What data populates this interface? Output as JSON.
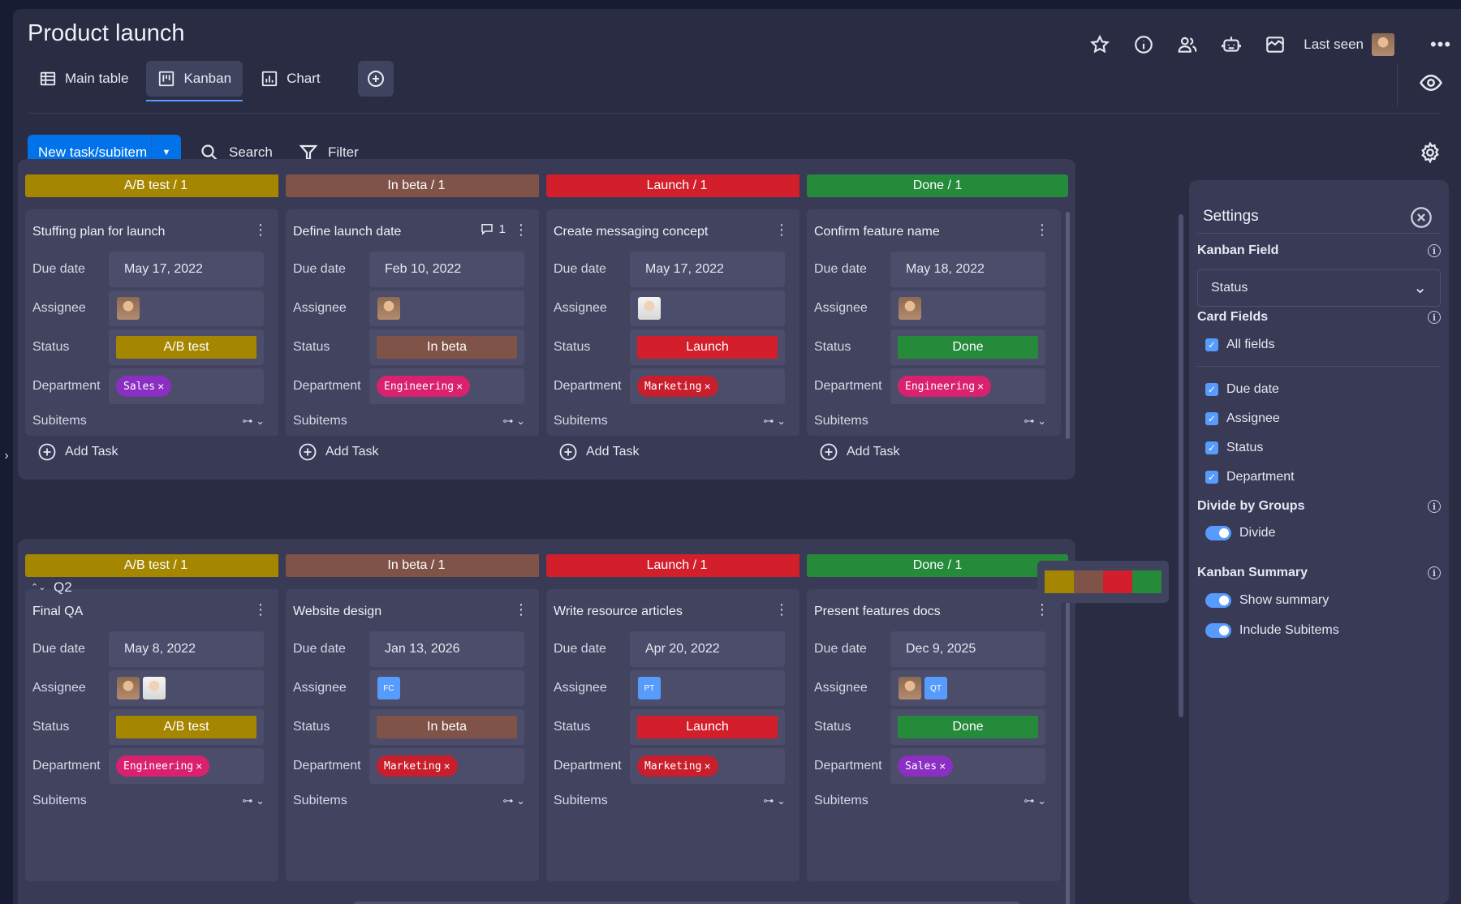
{
  "app": {
    "title": "Product launch",
    "last_seen_label": "Last seen",
    "more_label": "•••"
  },
  "tabs": [
    {
      "label": "Main table",
      "icon": "table-icon"
    },
    {
      "label": "Kanban",
      "icon": "kanban-icon",
      "active": true
    },
    {
      "label": "Chart",
      "icon": "chart-icon"
    }
  ],
  "toolbar": {
    "new_label": "New task/subitem",
    "dropdown_glyph": "▼",
    "search_label": "Search",
    "filter_label": "Filter"
  },
  "labels": {
    "due_date": "Due date",
    "assignee": "Assignee",
    "status": "Status",
    "department": "Department",
    "subitems": "Subitems",
    "add_task": "Add Task",
    "remove": "×",
    "menu": "⋮",
    "tree": "⊶ ⌄"
  },
  "colors": {
    "ab_test": "#a58600",
    "in_beta": "#7f5347",
    "launch": "#d21f2b",
    "done": "#258a3a",
    "sales": "#8b2fc2",
    "engineering": "#d9216f",
    "marketing": "#c91f2c",
    "accent": "#0073ea"
  },
  "groups": [
    {
      "columns": [
        {
          "header": "A/B test / 1",
          "card": {
            "title": "Stuffing plan for launch",
            "due": "May 17, 2022",
            "assignees": [
              "photo-a"
            ],
            "status": "A/B test",
            "department": "Sales"
          }
        },
        {
          "header": "In beta / 1",
          "card": {
            "title": "Define launch date",
            "comments": "1",
            "due": "Feb 10, 2022",
            "assignees": [
              "photo-a"
            ],
            "status": "In beta",
            "department": "Engineering"
          }
        },
        {
          "header": "Launch / 1",
          "card": {
            "title": "Create messaging concept",
            "due": "May 17, 2022",
            "assignees": [
              "photo-b"
            ],
            "status": "Launch",
            "department": "Marketing"
          }
        },
        {
          "header": "Done / 1",
          "card": {
            "title": "Confirm feature name",
            "due": "May 18, 2022",
            "assignees": [
              "photo-a"
            ],
            "status": "Done",
            "department": "Engineering"
          }
        }
      ]
    },
    {
      "name": "Q2",
      "collapse_glyph": "⌃⌄",
      "columns": [
        {
          "header": "A/B test / 1",
          "card": {
            "title": "Final QA",
            "due": "May 8, 2022",
            "assignees": [
              "photo-a",
              "photo-b"
            ],
            "status": "A/B test",
            "department": "Engineering"
          }
        },
        {
          "header": "In beta / 1",
          "card": {
            "title": "Website design",
            "due": "Jan 13, 2026",
            "assignees": [
              "FC"
            ],
            "status": "In beta",
            "department": "Marketing"
          }
        },
        {
          "header": "Launch / 1",
          "card": {
            "title": "Write resource articles",
            "due": "Apr 20, 2022",
            "assignees": [
              "PT"
            ],
            "status": "Launch",
            "department": "Marketing"
          }
        },
        {
          "header": "Done / 1",
          "card": {
            "title": "Present features docs",
            "due": "Dec 9, 2025",
            "assignees": [
              "photo-a",
              "QT"
            ],
            "status": "Done",
            "department": "Sales"
          }
        }
      ]
    }
  ],
  "settings": {
    "title": "Settings",
    "kanban_field_label": "Kanban Field",
    "kanban_field_value": "Status",
    "card_fields_label": "Card Fields",
    "all_fields": "All fields",
    "fields": [
      "Due date",
      "Assignee",
      "Status",
      "Department"
    ],
    "divide_label": "Divide by Groups",
    "divide_toggle": "Divide",
    "summary_label": "Kanban Summary",
    "show_summary": "Show summary",
    "include_subitems": "Include Subitems",
    "check_glyph": "✓",
    "info_glyph": "i",
    "chevron_glyph": "⌄"
  }
}
